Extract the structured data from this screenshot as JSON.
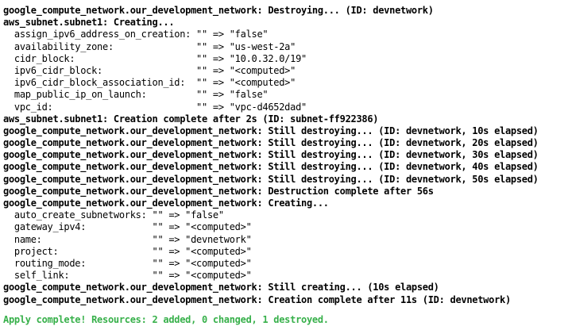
{
  "terminal": {
    "lines": [
      {
        "style": "bold",
        "text": "google_compute_network.our_development_network: Destroying... (ID: devnetwork)"
      },
      {
        "style": "bold",
        "text": "aws_subnet.subnet1: Creating..."
      },
      {
        "style": "normal",
        "text": "  assign_ipv6_address_on_creation: \"\" => \"false\""
      },
      {
        "style": "normal",
        "text": "  availability_zone:               \"\" => \"us-west-2a\""
      },
      {
        "style": "normal",
        "text": "  cidr_block:                      \"\" => \"10.0.32.0/19\""
      },
      {
        "style": "normal",
        "text": "  ipv6_cidr_block:                 \"\" => \"<computed>\""
      },
      {
        "style": "normal",
        "text": "  ipv6_cidr_block_association_id:  \"\" => \"<computed>\""
      },
      {
        "style": "normal",
        "text": "  map_public_ip_on_launch:         \"\" => \"false\""
      },
      {
        "style": "normal",
        "text": "  vpc_id:                          \"\" => \"vpc-d4652dad\""
      },
      {
        "style": "bold",
        "text": "aws_subnet.subnet1: Creation complete after 2s (ID: subnet-ff922386)"
      },
      {
        "style": "bold",
        "text": "google_compute_network.our_development_network: Still destroying... (ID: devnetwork, 10s elapsed)"
      },
      {
        "style": "bold",
        "text": "google_compute_network.our_development_network: Still destroying... (ID: devnetwork, 20s elapsed)"
      },
      {
        "style": "bold",
        "text": "google_compute_network.our_development_network: Still destroying... (ID: devnetwork, 30s elapsed)"
      },
      {
        "style": "bold",
        "text": "google_compute_network.our_development_network: Still destroying... (ID: devnetwork, 40s elapsed)"
      },
      {
        "style": "bold",
        "text": "google_compute_network.our_development_network: Still destroying... (ID: devnetwork, 50s elapsed)"
      },
      {
        "style": "bold",
        "text": "google_compute_network.our_development_network: Destruction complete after 56s"
      },
      {
        "style": "bold",
        "text": "google_compute_network.our_development_network: Creating..."
      },
      {
        "style": "normal",
        "text": "  auto_create_subnetworks: \"\" => \"false\""
      },
      {
        "style": "normal",
        "text": "  gateway_ipv4:            \"\" => \"<computed>\""
      },
      {
        "style": "normal",
        "text": "  name:                    \"\" => \"devnetwork\""
      },
      {
        "style": "normal",
        "text": "  project:                 \"\" => \"<computed>\""
      },
      {
        "style": "normal",
        "text": "  routing_mode:            \"\" => \"<computed>\""
      },
      {
        "style": "normal",
        "text": "  self_link:               \"\" => \"<computed>\""
      },
      {
        "style": "bold",
        "text": "google_compute_network.our_development_network: Still creating... (10s elapsed)"
      },
      {
        "style": "bold",
        "text": "google_compute_network.our_development_network: Creation complete after 11s (ID: devnetwork)"
      },
      {
        "style": "blank",
        "text": ""
      },
      {
        "style": "green",
        "text": "Apply complete! Resources: 2 added, 0 changed, 1 destroyed."
      }
    ]
  },
  "colors": {
    "background": "#ffffff",
    "text": "#000000",
    "success": "#37b04a"
  }
}
